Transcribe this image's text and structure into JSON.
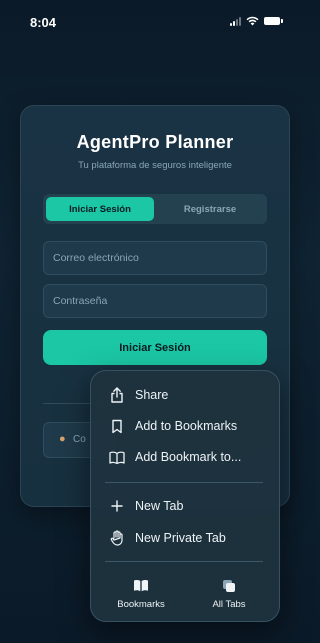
{
  "status_bar": {
    "time": "8:04"
  },
  "login_card": {
    "app_title": "AgentPro Planner",
    "subtitle": "Tu plataforma de seguros inteligente",
    "tabs": [
      {
        "label": "Iniciar Sesión",
        "active": true
      },
      {
        "label": "Registrarse",
        "active": false
      }
    ],
    "email_placeholder": "Correo electrónico",
    "password_placeholder": "Contraseña",
    "submit_label": "Iniciar Sesión",
    "social_button_label": "Co"
  },
  "context_menu": {
    "items": [
      {
        "label": "Share",
        "icon": "share-icon"
      },
      {
        "label": "Add to Bookmarks",
        "icon": "bookmark-icon"
      },
      {
        "label": "Add Bookmark to...",
        "icon": "book-icon"
      },
      {
        "label": "New Tab",
        "icon": "plus-icon"
      },
      {
        "label": "New Private Tab",
        "icon": "hand-icon"
      }
    ],
    "bottom": [
      {
        "label": "Bookmarks",
        "icon": "book-open-icon"
      },
      {
        "label": "All Tabs",
        "icon": "tabs-icon"
      }
    ]
  },
  "colors": {
    "accent": "#1bc7a5",
    "background": "#0f2332",
    "card": "#1a3344",
    "menu": "#1e323e"
  }
}
